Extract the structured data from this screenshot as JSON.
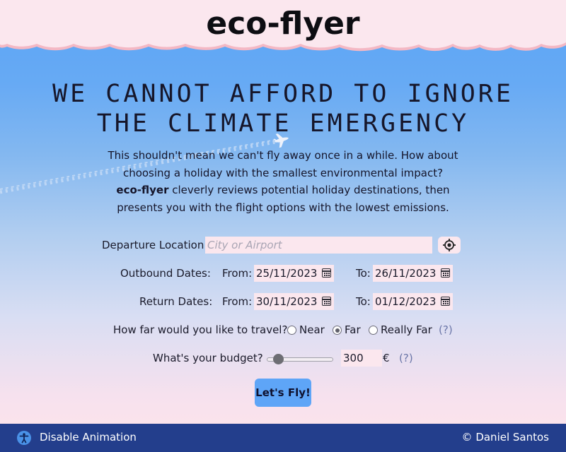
{
  "app": {
    "logo": "eco-flyer"
  },
  "hero": {
    "headline_line1": "WE CANNOT AFFORD TO IGNORE",
    "headline_line2": "THE CLIMATE EMERGENCY",
    "intro_1": "This shouldn't mean we can't fly away once in a while. How about",
    "intro_2": "choosing a holiday with the smallest environmental impact?",
    "intro_brand": "eco-flyer",
    "intro_3": " cleverly reviews potential holiday destinations, then",
    "intro_4": "presents you with the flight options with the lowest emissions."
  },
  "form": {
    "departure_label": "Departure Location",
    "departure_placeholder": "City or Airport",
    "departure_value": "",
    "outbound_label": "Outbound Dates:",
    "return_label": "Return Dates:",
    "from_label": "From:",
    "to_label": "To:",
    "outbound_from": "25/11/2023",
    "outbound_to": "26/11/2023",
    "return_from": "30/11/2023",
    "return_to": "01/12/2023",
    "distance_question": "How far would you like to travel?",
    "distance_options": [
      "Near",
      "Far",
      "Really Far"
    ],
    "distance_selected": "Far",
    "help_text": "(?)",
    "budget_label": "What's your budget?",
    "budget_value": "300",
    "budget_fraction": 0.12,
    "currency": "€",
    "submit_label": "Let's Fly!"
  },
  "footer": {
    "animation_toggle": "Disable Animation",
    "copyright": "© Daniel Santos"
  },
  "colors": {
    "sky_top": "#5aa4f6",
    "sky_bottom": "#fbe3ec",
    "cloud": "#fbe7ee",
    "cloud_edge": "#f4b8c4",
    "footer_bg": "#233e8c",
    "button": "#5ea5f7"
  },
  "icons": [
    "locate-icon",
    "calendar-icon",
    "accessibility-icon",
    "plane-icon"
  ]
}
